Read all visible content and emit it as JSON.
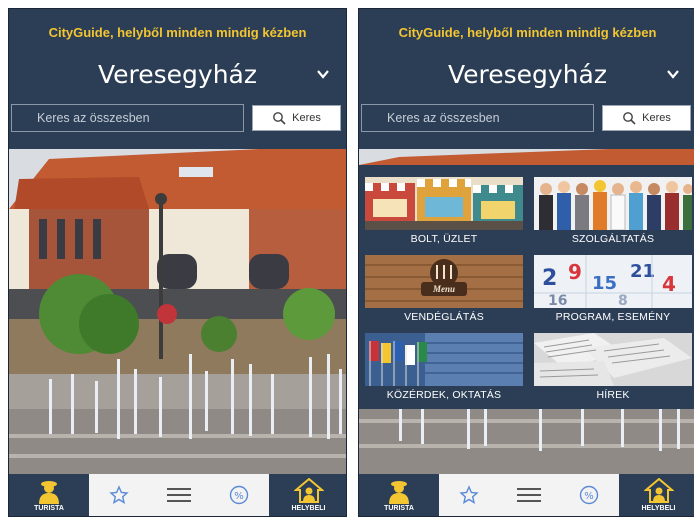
{
  "screens": [
    {
      "tagline": "CityGuide, helyből minden mindig kézben",
      "city": "Veresegyház",
      "search": {
        "placeholder": "Keres az összesben",
        "button": "Keres"
      },
      "tabs": {
        "tourist": "TURISTA",
        "local": "HELYBELI"
      }
    },
    {
      "tagline": "CityGuide, helyből minden mindig kézben",
      "city": "Veresegyház",
      "search": {
        "placeholder": "Keres az összesben",
        "button": "Keres"
      },
      "categories": [
        {
          "label": "BOLT, ÜZLET",
          "icon": "shop-icon"
        },
        {
          "label": "SZOLGÁLTATÁS",
          "icon": "services-icon"
        },
        {
          "label": "VENDÉGLÁTÁS",
          "icon": "menu-icon",
          "badge": "Menu"
        },
        {
          "label": "PROGRAM, ESEMÉNY",
          "icon": "calendar-icon"
        },
        {
          "label": "KÖZÉRDEK, OKTATÁS",
          "icon": "flags-icon"
        },
        {
          "label": "HÍREK",
          "icon": "newspaper-icon"
        }
      ],
      "tabs": {
        "tourist": "TURISTA",
        "local": "HELYBELI"
      }
    }
  ],
  "colors": {
    "navy": "#2c3e55",
    "accent": "#f2c531",
    "tab_bg": "#f3f3f3",
    "icon_blue": "#5b8ad6"
  }
}
